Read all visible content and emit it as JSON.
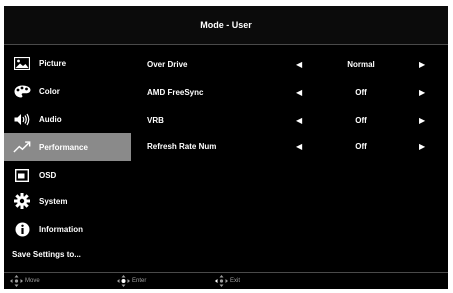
{
  "header": {
    "title": "Mode - User"
  },
  "sidebar": {
    "items": [
      {
        "label": "Picture",
        "icon": "picture-icon"
      },
      {
        "label": "Color",
        "icon": "palette-icon"
      },
      {
        "label": "Audio",
        "icon": "speaker-icon"
      },
      {
        "label": "Performance",
        "icon": "performance-graph-icon",
        "active": true
      },
      {
        "label": "OSD",
        "icon": "osd-window-icon"
      },
      {
        "label": "System",
        "icon": "gear-icon"
      },
      {
        "label": "Information",
        "icon": "info-icon"
      }
    ],
    "save_label": "Save Settings to..."
  },
  "settings": [
    {
      "label": "Over Drive",
      "value": "Normal"
    },
    {
      "label": "AMD FreeSync",
      "value": "Off"
    },
    {
      "label": "VRB",
      "value": "Off"
    },
    {
      "label": "Refresh Rate Num",
      "value": "Off"
    }
  ],
  "footer": {
    "move": "Move",
    "enter": "Enter",
    "exit": "Exit"
  },
  "colors": {
    "active_bg": "#8a8a8a",
    "background": "#000000",
    "text": "#ffffff"
  }
}
